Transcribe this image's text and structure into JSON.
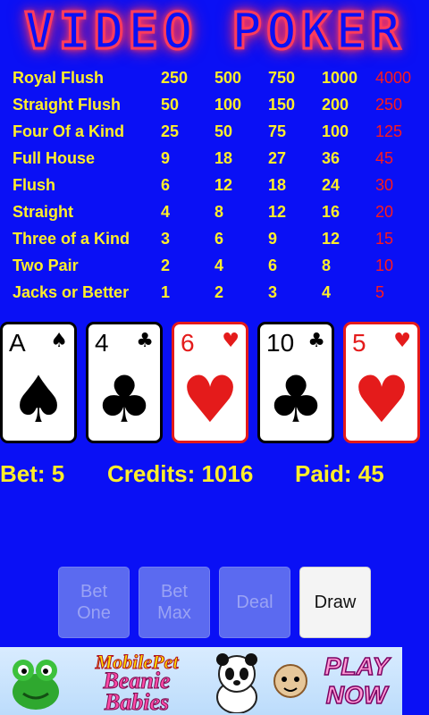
{
  "title": "VIDEO POKER",
  "paytable": [
    {
      "hand": "Royal Flush",
      "pays": [
        "250",
        "500",
        "750",
        "1000",
        "4000"
      ]
    },
    {
      "hand": "Straight Flush",
      "pays": [
        "50",
        "100",
        "150",
        "200",
        "250"
      ]
    },
    {
      "hand": "Four Of a Kind",
      "pays": [
        "25",
        "50",
        "75",
        "100",
        "125"
      ]
    },
    {
      "hand": "Full House",
      "pays": [
        "9",
        "18",
        "27",
        "36",
        "45"
      ]
    },
    {
      "hand": "Flush",
      "pays": [
        "6",
        "12",
        "18",
        "24",
        "30"
      ]
    },
    {
      "hand": "Straight",
      "pays": [
        "4",
        "8",
        "12",
        "16",
        "20"
      ]
    },
    {
      "hand": "Three of a Kind",
      "pays": [
        "3",
        "6",
        "9",
        "12",
        "15"
      ]
    },
    {
      "hand": "Two Pair",
      "pays": [
        "2",
        "4",
        "6",
        "8",
        "10"
      ]
    },
    {
      "hand": "Jacks or Better",
      "pays": [
        "1",
        "2",
        "3",
        "4",
        "5"
      ]
    }
  ],
  "cards": [
    {
      "rank": "A",
      "suit": "♠",
      "suit_name": "spade-icon",
      "color": "black"
    },
    {
      "rank": "4",
      "suit": "♣",
      "suit_name": "club-icon",
      "color": "black"
    },
    {
      "rank": "6",
      "suit": "♥",
      "suit_name": "heart-icon",
      "color": "red"
    },
    {
      "rank": "10",
      "suit": "♣",
      "suit_name": "club-icon",
      "color": "black"
    },
    {
      "rank": "5",
      "suit": "♥",
      "suit_name": "heart-icon",
      "color": "red"
    }
  ],
  "status": {
    "bet": "Bet: 5",
    "credits": "Credits: 1016",
    "paid": "Paid: 45"
  },
  "buttons": {
    "bet_one": "Bet\nOne",
    "bet_max": "Bet\nMax",
    "deal": "Deal",
    "draw": "Draw"
  },
  "ad": {
    "line1": "MobilePet",
    "line2": "Beanie\nBabies",
    "cta": "PLAY\nNOW"
  },
  "colors": {
    "background": "#0a10f5",
    "text": "#ffee2a",
    "highlight_column": "#ff1a1a",
    "title_neon": "#ff3b5c"
  }
}
